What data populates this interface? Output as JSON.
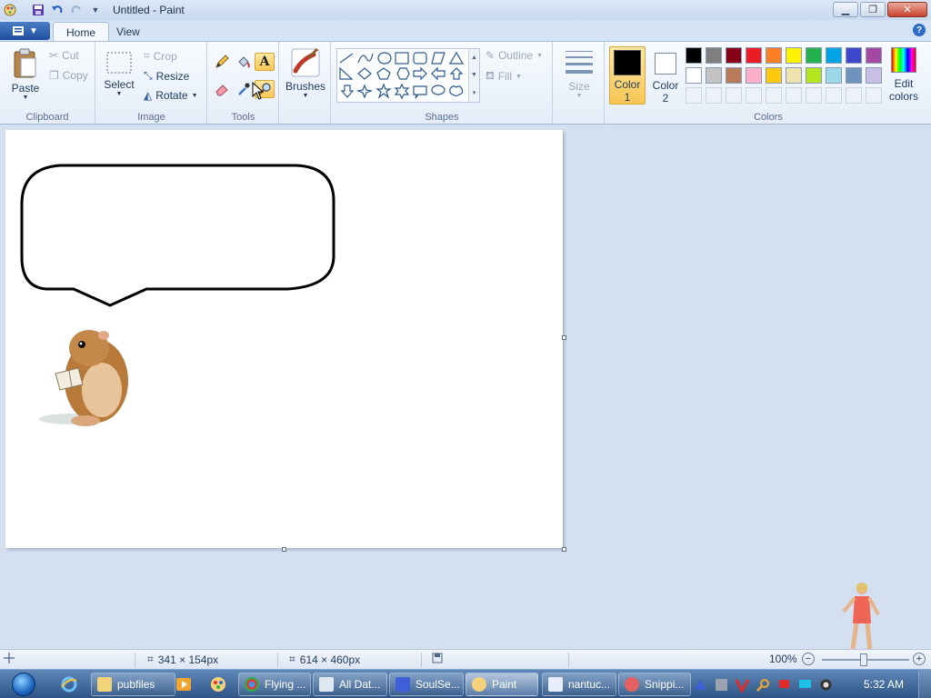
{
  "window": {
    "title": "Untitled - Paint"
  },
  "tabs": {
    "home": "Home",
    "view": "View"
  },
  "clipboard": {
    "paste": "Paste",
    "cut": "Cut",
    "copy": "Copy",
    "group_label": "Clipboard"
  },
  "image": {
    "select": "Select",
    "crop": "Crop",
    "resize": "Resize",
    "rotate": "Rotate",
    "group_label": "Image"
  },
  "tools": {
    "group_label": "Tools"
  },
  "brushes": {
    "label": "Brushes"
  },
  "shapes": {
    "outline": "Outline",
    "fill": "Fill",
    "group_label": "Shapes"
  },
  "size": {
    "label": "Size"
  },
  "colors": {
    "color1_line1": "Color",
    "color1_line2": "1",
    "color2_line1": "Color",
    "color2_line2": "2",
    "edit_line1": "Edit",
    "edit_line2": "colors",
    "group_label": "Colors",
    "color1_value": "#000000",
    "color2_value": "#ffffff",
    "palette_row1": [
      "#000000",
      "#7f7f7f",
      "#880015",
      "#ed1c24",
      "#ff7f27",
      "#fff200",
      "#22b14c",
      "#00a2e8",
      "#3f48cc",
      "#a349a4"
    ],
    "palette_row2": [
      "#ffffff",
      "#c3c3c3",
      "#b97a57",
      "#ffaec9",
      "#ffc90e",
      "#efe4b0",
      "#b5e61d",
      "#99d9ea",
      "#7092be",
      "#c8bfe7"
    ]
  },
  "status": {
    "selection_size": "341 × 154px",
    "image_size": "614 × 460px",
    "zoom": "100%"
  },
  "taskbar": {
    "tasks": [
      "pubfiles",
      "Flying ...",
      "All Dat...",
      "SoulSe...",
      "Paint",
      "nantuc...",
      "Snippi..."
    ],
    "clock": "5:32 AM"
  }
}
